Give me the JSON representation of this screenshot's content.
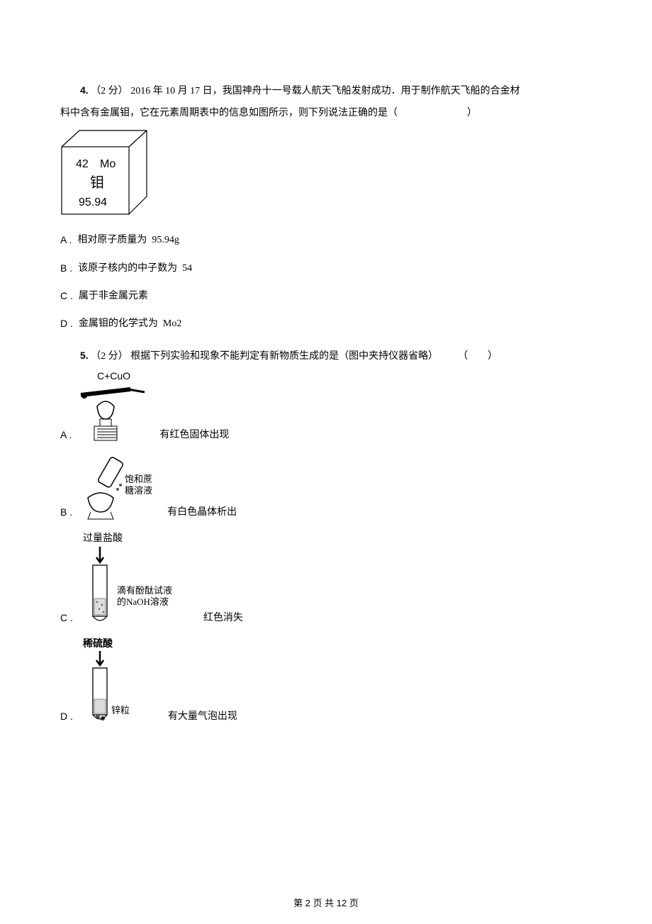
{
  "q4": {
    "number": "4.",
    "points": "（2 分）",
    "line1_a": "2016 年 10 月 17 日，我国神舟十一号载人航天飞船发射成功．用于制作航天飞船的合金材",
    "line2": "料中含有金属钼，它在元素周期表中的信息如图所示，则下列说法正确的是（　　　　　　　）",
    "cube": {
      "num": "42",
      "sym": "Mo",
      "name": "钼",
      "mass": "95.94"
    },
    "A": {
      "label": "A .",
      "text": "相对原子质量为 95.94g"
    },
    "B": {
      "label": "B .",
      "text": "该原子核内的中子数为 54"
    },
    "C": {
      "label": "C .",
      "text": "属于非金属元素"
    },
    "D": {
      "label": "D .",
      "text": "金属钼的化学式为 Mo2"
    }
  },
  "q5": {
    "number": "5.",
    "points": "（2 分）",
    "line1": "根据下列实验和现象不能判定有新物质生成的是（图中夹持仪器省略）　　　（　　）",
    "A": {
      "label": "A .",
      "img_label": "C+CuO",
      "text": "有红色固体出现"
    },
    "B": {
      "label": "B .",
      "img_l1": "饱和蔗",
      "img_l2": "糖溶液",
      "text": "有白色晶体析出"
    },
    "C": {
      "label": "C .",
      "top": "过量盐酸",
      "side1": "滴有酚酞试液",
      "side2": "的NaOH溶液",
      "text": "红色消失"
    },
    "D": {
      "label": "D .",
      "top": "稀硫酸",
      "side": "锌粒",
      "text": "有大量气泡出现"
    }
  },
  "pager": {
    "a": "第 ",
    "b": "2",
    "c": " 页 共 ",
    "d": "12",
    "e": " 页"
  }
}
